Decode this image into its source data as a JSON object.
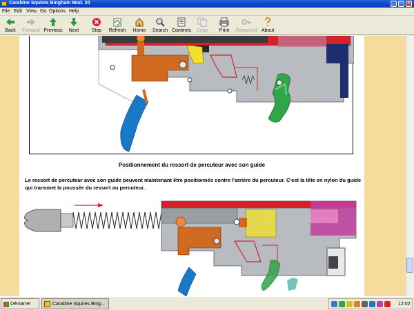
{
  "window": {
    "title": "Carabine Squires Bingham Mod. 20",
    "controls": {
      "minimize": "_",
      "maximize": "□",
      "close": "×"
    }
  },
  "menu": [
    "File",
    "Edit",
    "View",
    "Go",
    "Options",
    "Help"
  ],
  "toolbar": [
    {
      "label": "Back",
      "icon": "back-arrow-icon",
      "enabled": true
    },
    {
      "label": "Forward",
      "icon": "forward-arrow-icon",
      "enabled": false
    },
    {
      "label": "Previous",
      "icon": "up-arrow-icon",
      "enabled": true
    },
    {
      "label": "Next",
      "icon": "down-arrow-icon",
      "enabled": true
    },
    {
      "label": "Stop",
      "icon": "stop-icon",
      "enabled": true
    },
    {
      "label": "Refresh",
      "icon": "refresh-icon",
      "enabled": true
    },
    {
      "label": "Home",
      "icon": "home-icon",
      "enabled": true
    },
    {
      "label": "Search",
      "icon": "search-icon",
      "enabled": true
    },
    {
      "label": "Contents",
      "icon": "contents-icon",
      "enabled": true
    },
    {
      "label": "Copy",
      "icon": "copy-icon",
      "enabled": false
    },
    {
      "label": "Print",
      "icon": "print-icon",
      "enabled": true
    },
    {
      "label": "Password",
      "icon": "key-icon",
      "enabled": false
    },
    {
      "label": "About",
      "icon": "question-icon",
      "enabled": true
    }
  ],
  "content": {
    "caption": "Positionnement du ressort de percuteur avec son guide",
    "paragraph": "Le ressort de percuteur avec son guide peuvent maintenant être positionnés contre l'arrière du percuteur. C'est la tête en nylon du guide qui transmet la poussée du ressort au percuteur."
  },
  "colors": {
    "side_band": "#f5dc9c",
    "mechanism_red": "#d8202a",
    "trigger_blue": "#1a78c8",
    "sear_green": "#2fa648",
    "slide_orange": "#d06a20",
    "receiver_gray": "#b8bcc0",
    "magazine_navy": "#1c2e6e"
  },
  "taskbar": {
    "start_label": "Démarrer",
    "task_label": "Carabine Squires Bing...",
    "clock": "12:02"
  }
}
